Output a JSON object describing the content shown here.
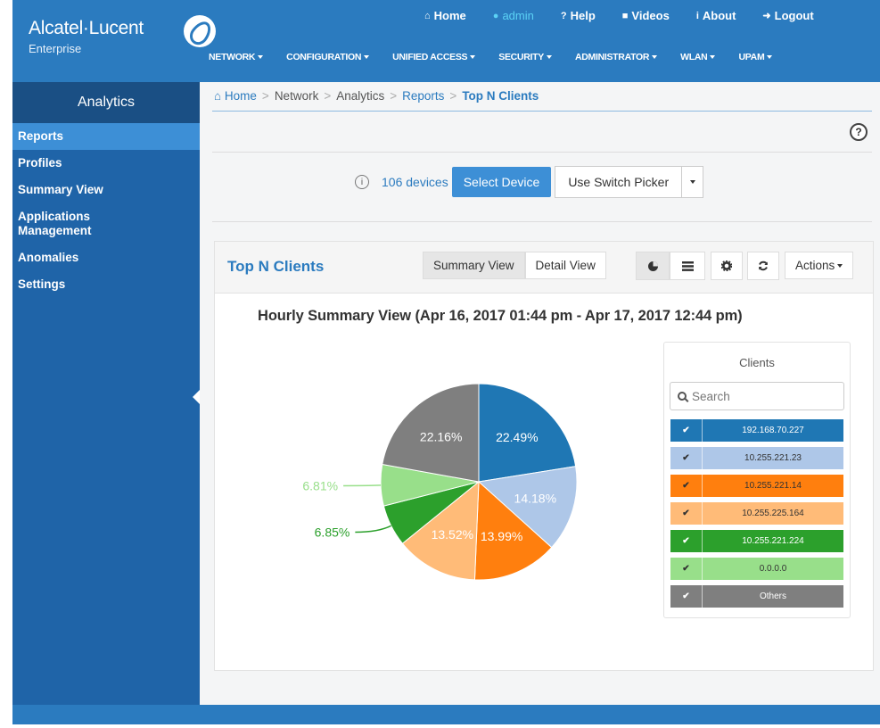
{
  "header": {
    "logo_name": "Alcatel·Lucent",
    "logo_sub": "Enterprise",
    "top_links": [
      {
        "icon": "home-icon",
        "glyph": "⌂",
        "label": "Home"
      },
      {
        "icon": "user-icon",
        "glyph": "●",
        "label": "admin"
      },
      {
        "icon": "help-icon",
        "glyph": "?",
        "label": "Help"
      },
      {
        "icon": "video-icon",
        "glyph": "■",
        "label": "Videos"
      },
      {
        "icon": "info-icon",
        "glyph": "i",
        "label": "About"
      },
      {
        "icon": "logout-icon",
        "glyph": "➜",
        "label": "Logout"
      }
    ],
    "main_nav": [
      "NETWORK",
      "CONFIGURATION",
      "UNIFIED ACCESS",
      "SECURITY",
      "ADMINISTRATOR",
      "WLAN",
      "UPAM"
    ]
  },
  "sidebar": {
    "title": "Analytics",
    "items": [
      "Reports",
      "Profiles",
      "Summary View",
      "Applications Management",
      "Anomalies",
      "Settings"
    ],
    "active_index": 0
  },
  "breadcrumb": {
    "home": "Home",
    "items": [
      "Network",
      "Analytics",
      "Reports",
      "Top N Clients"
    ]
  },
  "toolbar": {
    "devices_count": "106 devices",
    "select_device": "Select Device",
    "switch_picker": "Use Switch Picker",
    "help_glyph": "?",
    "info_glyph": "i"
  },
  "panel": {
    "title": "Top N Clients",
    "summary_view": "Summary View",
    "detail_view": "Detail View",
    "actions": "Actions",
    "chart_heading": "Hourly Summary View (Apr 16, 2017 01:44 pm - Apr 17, 2017 12:44 pm)"
  },
  "legend": {
    "title": "Clients",
    "search_placeholder": "Search",
    "check_glyph": "✔"
  },
  "chart_data": {
    "type": "pie",
    "title": "Hourly Summary View (Apr 16, 2017 01:44 pm - Apr 17, 2017 12:44 pm)",
    "slices": [
      {
        "label": "192.168.70.227",
        "value": 22.49,
        "display": "22.49%",
        "color": "#1f77b4",
        "text_color": "#ffffff"
      },
      {
        "label": "10.255.221.23",
        "value": 14.18,
        "display": "14.18%",
        "color": "#aec7e8",
        "text_color": "#333333"
      },
      {
        "label": "10.255.221.14",
        "value": 13.99,
        "display": "13.99%",
        "color": "#ff7f0e",
        "text_color": "#333333"
      },
      {
        "label": "10.255.225.164",
        "value": 13.52,
        "display": "13.52%",
        "color": "#ffbb78",
        "text_color": "#333333"
      },
      {
        "label": "10.255.221.224",
        "value": 6.85,
        "display": "6.85%",
        "color": "#2ca02c",
        "text_color": "#ffffff"
      },
      {
        "label": "0.0.0.0",
        "value": 6.81,
        "display": "6.81%",
        "color": "#98df8a",
        "text_color": "#333333"
      },
      {
        "label": "Others",
        "value": 22.16,
        "display": "22.16%",
        "color": "#7f7f7f",
        "text_color": "#ffffff"
      }
    ],
    "legend_title": "Clients"
  }
}
